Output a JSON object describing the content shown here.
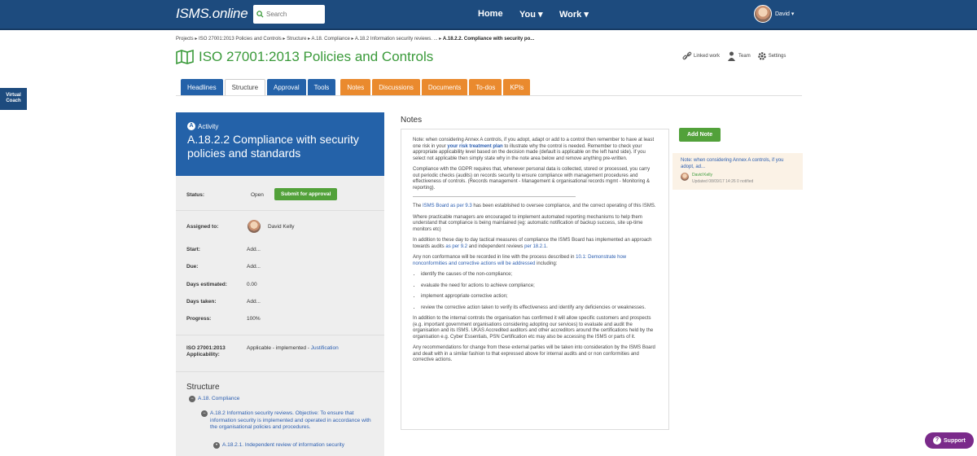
{
  "header": {
    "brand": "ISMS.online",
    "search_placeholder": "Search",
    "nav": [
      "Home",
      "You ▾",
      "Work ▾"
    ],
    "user_name": "David ▾"
  },
  "virtual_coach": "Virtual Coach",
  "breadcrumb": "Projects ▸ ISO 27001:2013 Policies and Controls ▸ Structure ▸ A.18. Compliance ▸ A.18.2 Information security reviews. ... ▸ ",
  "breadcrumb_current": "A.18.2.2. Compliance with security po...",
  "page_title": "ISO 27001:2013 Policies and Controls",
  "top_actions": {
    "linked": "Linked work",
    "team": "Team",
    "settings": "Settings"
  },
  "tabs": {
    "blue": [
      "Headlines",
      "Structure",
      "Approval",
      "Tools"
    ],
    "orange": [
      "Notes",
      "Discussions",
      "Documents",
      "To-dos",
      "KPIs"
    ],
    "active": "Structure"
  },
  "activity": {
    "kind": "Activity",
    "name": "A.18.2.2 Compliance with security policies and standards"
  },
  "props": {
    "status_label": "Status:",
    "status_value": "Open",
    "submit_button": "Submit for approval",
    "assigned_label": "Assigned to:",
    "assigned_value": "David Kelly",
    "start_label": "Start:",
    "start_value": "Add...",
    "due_label": "Due:",
    "due_value": "Add...",
    "days_est_label": "Days estimated:",
    "days_est_value": "0.00",
    "days_taken_label": "Days taken:",
    "days_taken_value": "Add...",
    "progress_label": "Progress:",
    "progress_value": "100%",
    "applicability_label_1": "ISO 27001:2013",
    "applicability_label_2": "Applicability:",
    "applicability_value": "Applicable - implemented - ",
    "justification_link": "Justification"
  },
  "structure": {
    "title": "Structure",
    "item1": "A.18. Compliance",
    "item2": "A.18.2 Information security reviews. Objective: To ensure that information security is implemented and operated in accordance with the organisational policies and procedures.",
    "item3": "A.18.2.1. Independent review of information security"
  },
  "notes": {
    "heading": "Notes",
    "p1_a": "Note: when considering Annex A controls, if you adopt, adapt or add to a control then remember to have at least one risk in your ",
    "p1_link": "your risk treatment plan",
    "p1_b": " to illustrate why the control is needed. Remember to check your appropriate applicability level based on the decision made (default is applicable on the left hand side). If you select not applicable then simply state why in the note area below and remove anything pre-written.",
    "p2": "Compliance with the GDPR requires that, whenever personal data is collected, stored or processed, you carry out periodic checks (audits) on records security to ensure compliance with management procedures and effectiveness of controls. (Records management - Management & organisational records mgmt - Monitoring & reporting).",
    "p3_link": "ISMS Board as per 9.3",
    "p3_b": " has been established to oversee compliance, and the correct operating of this ISMS.",
    "p3_a": "The ",
    "p4": "Where practicable managers are encouraged to implement automated reporting mechanisms to help them understand that compliance is being maintained (eg: automatic notification of backup success, site up-time monitors etc)",
    "p5_a": "In addition to these day to day tactical measures of compliance the ISMS Board has implemented an approach towards audits ",
    "p5_link1": "as per 9.2",
    "p5_b": " and independent reviews ",
    "p5_link2": "per 18.2.1",
    "p6_a": "Any non conformance will be recorded in line with the process described in ",
    "p6_link": "10.1: Demonstrate how nonconformities and corrective actions will be addressed",
    "p6_b": " including:",
    "list": [
      "identify the causes of the non-compliance;",
      "evaluate the need for actions to achieve compliance;",
      "implement appropriate corrective action;",
      "review the corrective action taken to verify its effectiveness and identify any deficiencies or weaknesses."
    ],
    "p7": "In addition to the internal controls the organisation has confirmed it will allow specific customers and prospects (e.g. important government organisations considering adopting our services) to evaluate and audit the organisation and its ISMS. UKAS Accredited auditors and other accreditors around the certifications held by the organisation e.g. Cyber Essentials, PSN Certification etc may also be accessing the ISMS or parts of it.",
    "p8": "Any recommendations for change from these external parties will be taken into consideration by the ISMS Board and dealt with in a similar fashion to that expressed above for internal audits and or non conformities and corrective actions."
  },
  "add_note_button": "Add Note",
  "note_card": {
    "title": "Note: when considering Annex A controls, if you adopt, ad...",
    "author": "David Kelly",
    "updated": "Updated 08/09/17 14:26 0 notified"
  },
  "support_button": "Support",
  "colors": {
    "nav": "#1d4b7e",
    "blue_tab": "#2462a9",
    "orange_tab": "#ea8a2e",
    "green": "#52a13a",
    "title_green": "#3a9a3a"
  }
}
